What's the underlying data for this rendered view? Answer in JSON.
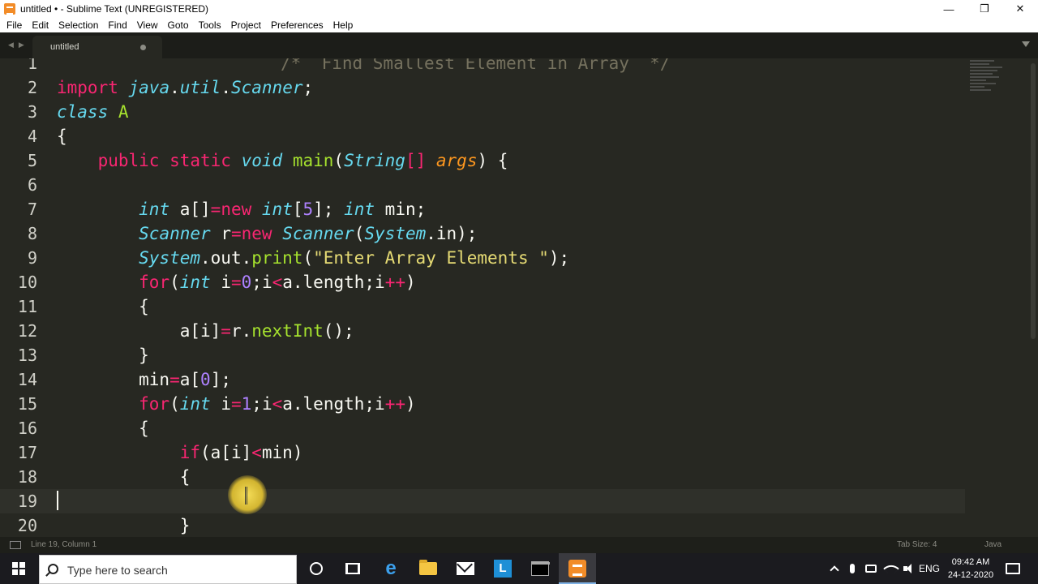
{
  "window": {
    "title": "untitled • - Sublime Text (UNREGISTERED)",
    "minimize_glyph": "—",
    "restore_glyph": "❐",
    "close_glyph": "✕"
  },
  "menu": [
    "File",
    "Edit",
    "Selection",
    "Find",
    "View",
    "Goto",
    "Tools",
    "Project",
    "Preferences",
    "Help"
  ],
  "tabs": {
    "nav_glyph": "◀▶",
    "active_label": "untitled"
  },
  "editor": {
    "current_line": 19,
    "lines": [
      {
        "n": "1",
        "code": "/*  Find Smallest Element in Array  */"
      },
      {
        "n": "2",
        "code": "import java.util.Scanner;"
      },
      {
        "n": "3",
        "code": "class A"
      },
      {
        "n": "4",
        "code": "{"
      },
      {
        "n": "5",
        "code": "    public static void main(String[] args) {"
      },
      {
        "n": "6",
        "code": ""
      },
      {
        "n": "7",
        "code": "        int a[]=new int[5]; int min;"
      },
      {
        "n": "8",
        "code": "        Scanner r=new Scanner(System.in);"
      },
      {
        "n": "9",
        "code": "        System.out.print(\"Enter Array Elements \");"
      },
      {
        "n": "10",
        "code": "        for(int i=0;i<a.length;i++)"
      },
      {
        "n": "11",
        "code": "        {"
      },
      {
        "n": "12",
        "code": "            a[i]=r.nextInt();"
      },
      {
        "n": "13",
        "code": "        }"
      },
      {
        "n": "14",
        "code": "        min=a[0];"
      },
      {
        "n": "15",
        "code": "        for(int i=1;i<a.length;i++)"
      },
      {
        "n": "16",
        "code": "        {"
      },
      {
        "n": "17",
        "code": "            if(a[i]<min)"
      },
      {
        "n": "18",
        "code": "            {"
      },
      {
        "n": "19",
        "code": ""
      },
      {
        "n": "20",
        "code": "            }"
      }
    ]
  },
  "status": {
    "position": "Line 19, Column 1",
    "tab_size": "Tab Size: 4",
    "syntax": "Java"
  },
  "taskbar": {
    "search_placeholder": "Type here to search",
    "language": "ENG",
    "time": "09:42 AM",
    "date": "24-12-2020",
    "apps": [
      "cortana",
      "task-view",
      "edge",
      "file-explorer",
      "mail",
      "l-app",
      "terminal",
      "sublime-text"
    ]
  },
  "colors": {
    "editor_bg": "#272822",
    "keyword": "#f92672",
    "type": "#66d9ef",
    "function": "#a6e22e",
    "string": "#e6db74",
    "number": "#ae81ff",
    "argument": "#fd971f",
    "comment": "#75715e"
  }
}
